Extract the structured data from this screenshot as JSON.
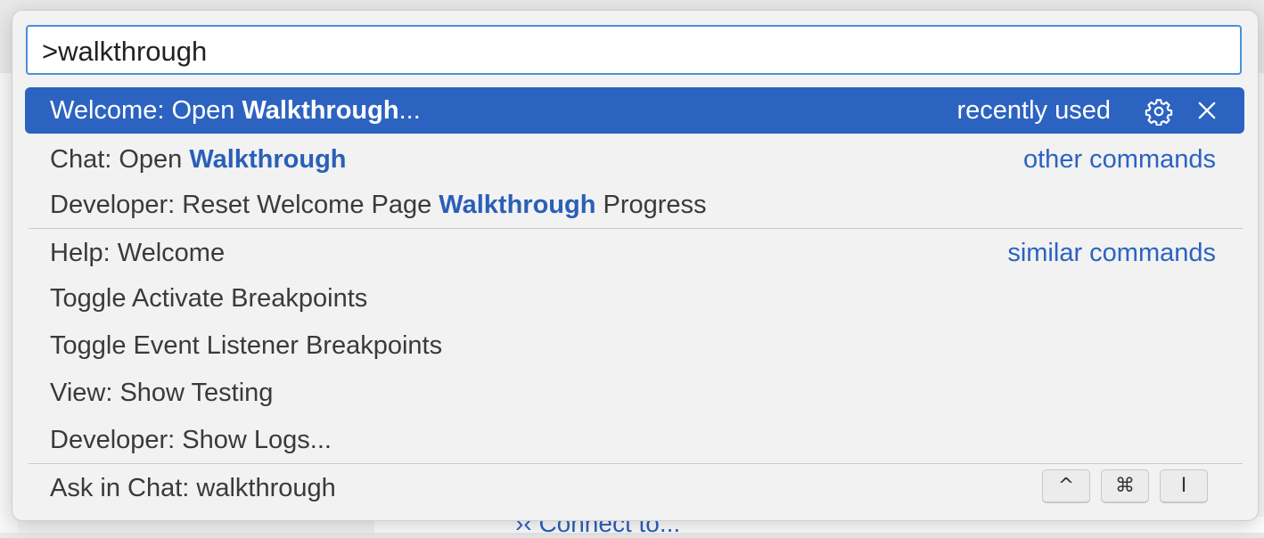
{
  "search": {
    "value": ">walkthrough"
  },
  "results": [
    {
      "prefix": "Welcome: Open ",
      "match": "Walkthrough",
      "suffix": "...",
      "side": "recently used",
      "selected": true
    },
    {
      "prefix": "Chat: Open ",
      "match": "Walkthrough",
      "suffix": "",
      "side": "other commands"
    },
    {
      "prefix": "Developer: Reset Welcome Page ",
      "match": "Walkthrough",
      "suffix": " Progress",
      "side": ""
    },
    {
      "label": "Help: Welcome",
      "side": "similar commands"
    },
    {
      "label": "Toggle Activate Breakpoints"
    },
    {
      "label": "Toggle Event Listener Breakpoints"
    },
    {
      "label": "View: Show Testing"
    },
    {
      "label": "Developer: Show Logs..."
    },
    {
      "label": "Ask in Chat: walkthrough"
    }
  ],
  "keys": [
    "^",
    "⌘",
    "I"
  ],
  "background": {
    "connect": "Connect to..."
  },
  "colors": {
    "accent": "#2c63c0",
    "match": "#2a5fb8",
    "focus_border": "#4a8fdc"
  },
  "icons": {
    "gear": "gear-icon",
    "close": "close-icon"
  }
}
